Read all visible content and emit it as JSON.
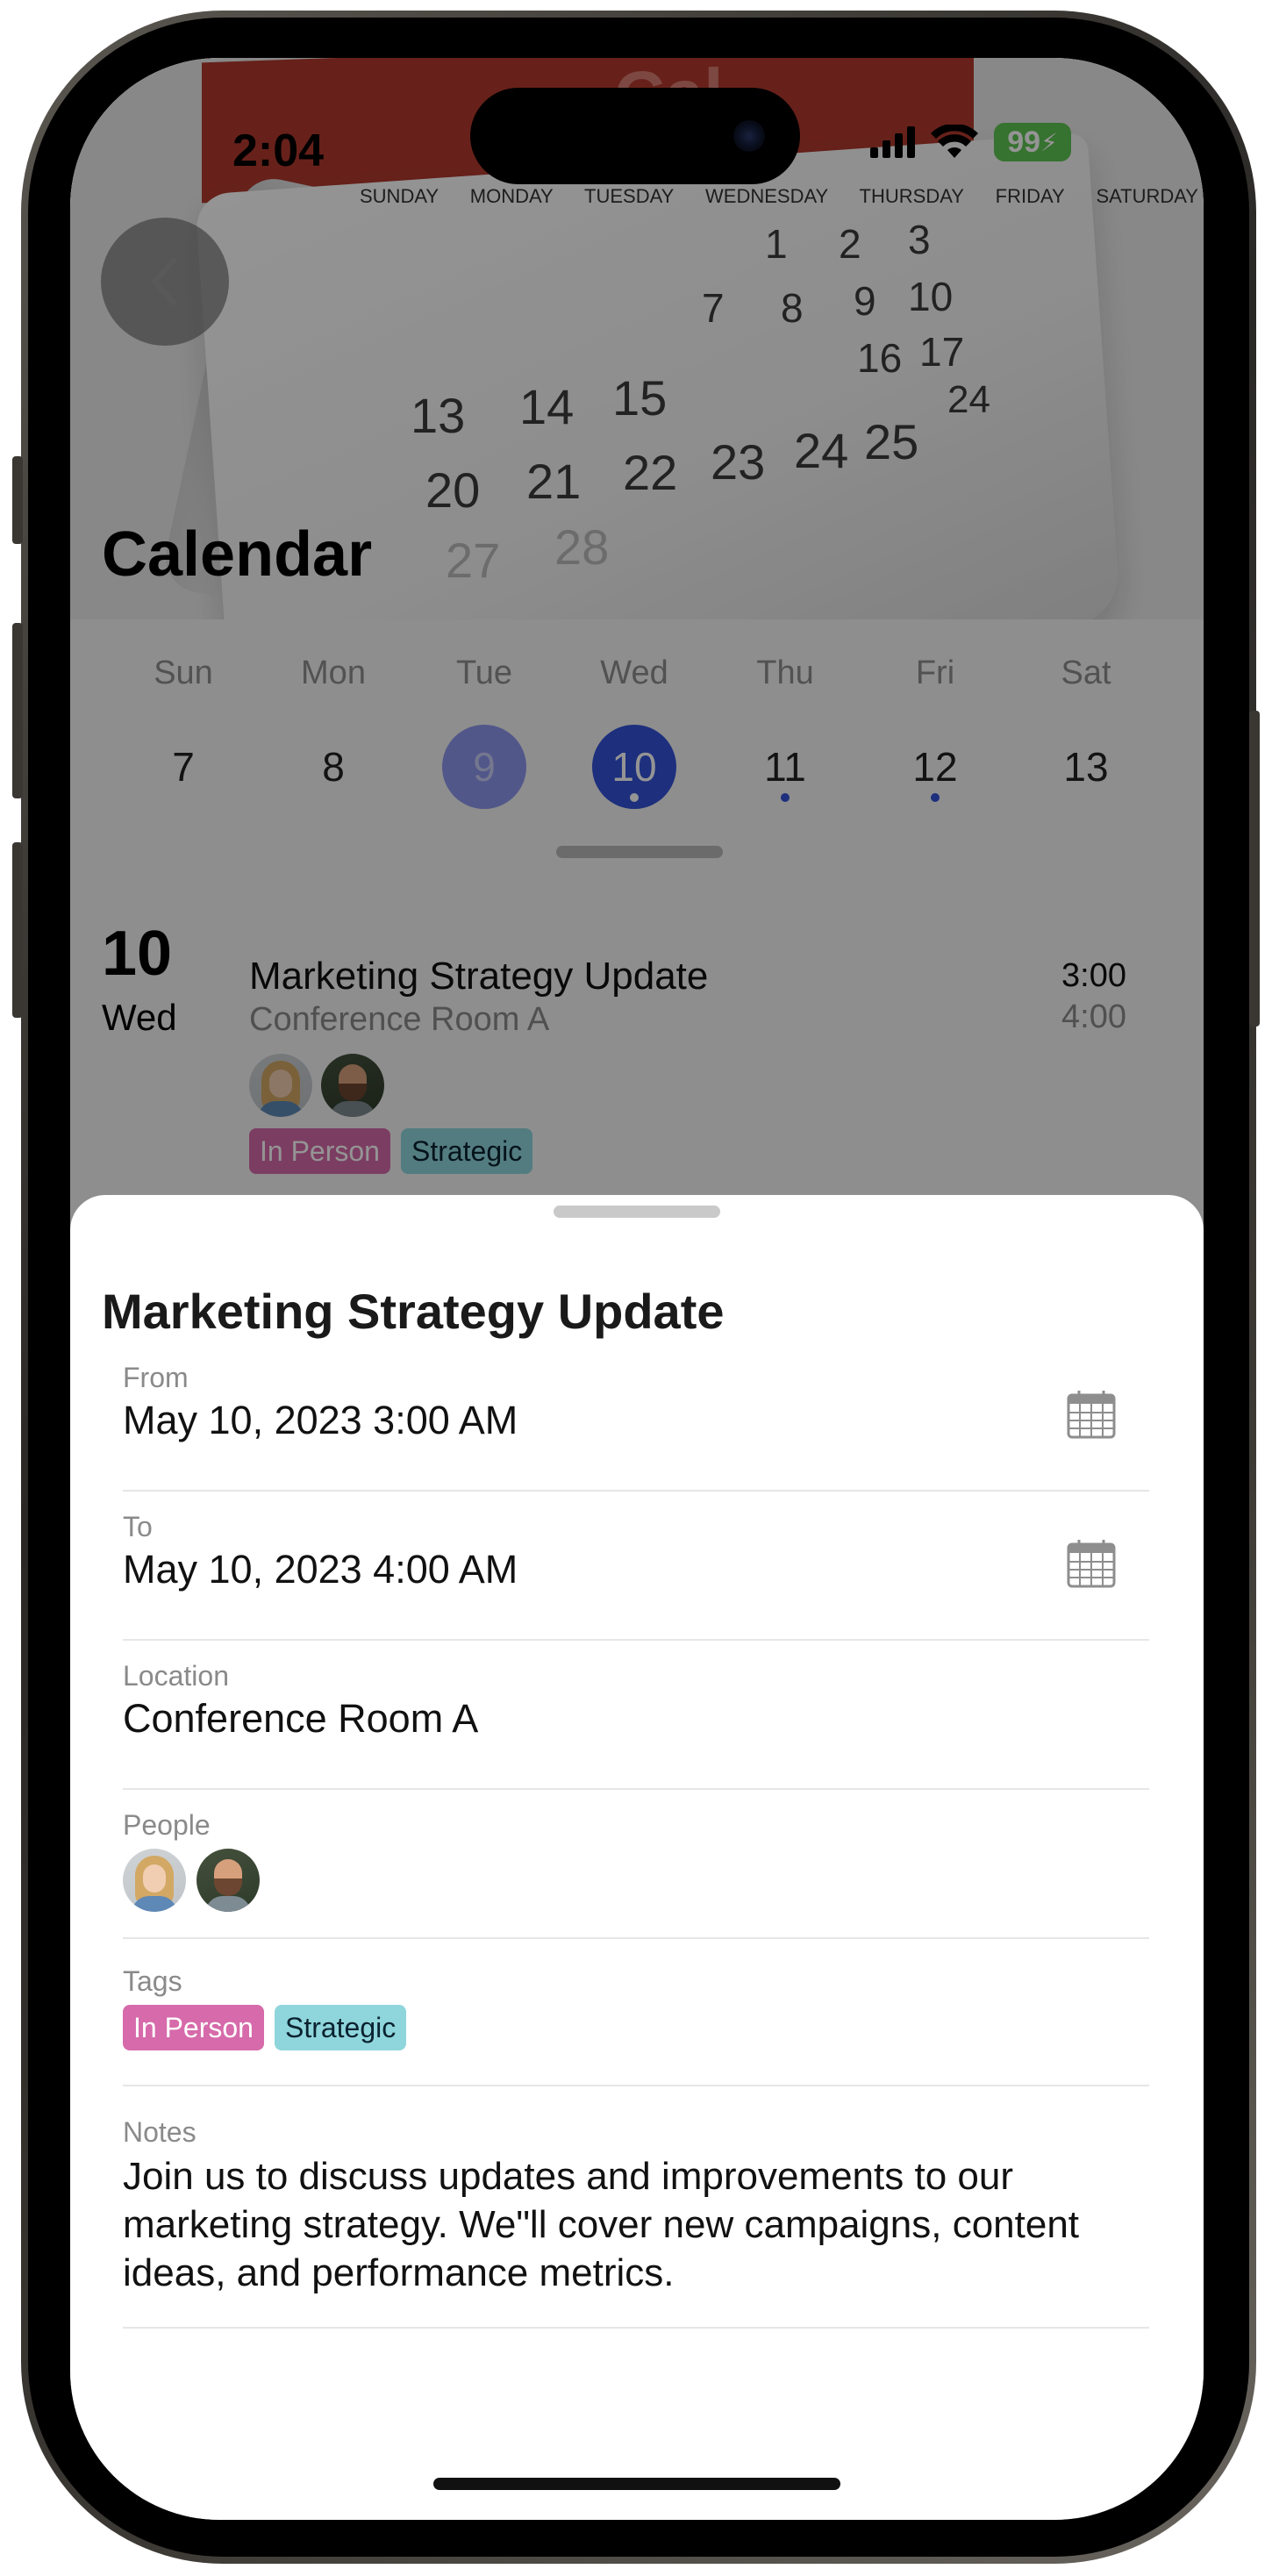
{
  "status_bar": {
    "time": "2:04",
    "battery": "99"
  },
  "hero": {
    "weekdays": [
      "SUNDAY",
      "MONDAY",
      "TUESDAY",
      "WEDNESDAY",
      "THURSDAY",
      "FRIDAY",
      "SATURDAY"
    ],
    "numbers": [
      "1",
      "2",
      "3",
      "7",
      "8",
      "9",
      "10",
      "16",
      "17",
      "13",
      "14",
      "15",
      "24",
      "20",
      "21",
      "22",
      "23",
      "24",
      "25",
      "27",
      "28"
    ]
  },
  "page": {
    "title": "Calendar"
  },
  "week": {
    "days": [
      {
        "name": "Sun",
        "num": "7"
      },
      {
        "name": "Mon",
        "num": "8"
      },
      {
        "name": "Tue",
        "num": "9"
      },
      {
        "name": "Wed",
        "num": "10"
      },
      {
        "name": "Thu",
        "num": "11"
      },
      {
        "name": "Fri",
        "num": "12"
      },
      {
        "name": "Sat",
        "num": "13"
      }
    ]
  },
  "event_list": {
    "day_number": "10",
    "day_name": "Wed",
    "title": "Marketing Strategy Update",
    "location": "Conference Room A",
    "start": "3:00",
    "end": "4:00",
    "tags": [
      "In Person",
      "Strategic"
    ]
  },
  "sheet": {
    "title": "Marketing Strategy Update",
    "from_label": "From",
    "from_value": "May 10, 2023 3:00 AM",
    "to_label": "To",
    "to_value": "May 10, 2023 4:00 AM",
    "location_label": "Location",
    "location_value": "Conference Room A",
    "people_label": "People",
    "tags_label": "Tags",
    "tags": [
      "In Person",
      "Strategic"
    ],
    "notes_label": "Notes",
    "notes_value": "Join us to discuss updates and improvements to our marketing strategy. We\"ll cover new campaigns, content ideas, and performance metrics."
  },
  "colors": {
    "accent": "#3251d8",
    "tag_in_person": "#d66aaa",
    "tag_strategic": "#8fd6dc",
    "battery": "#5ec454"
  }
}
